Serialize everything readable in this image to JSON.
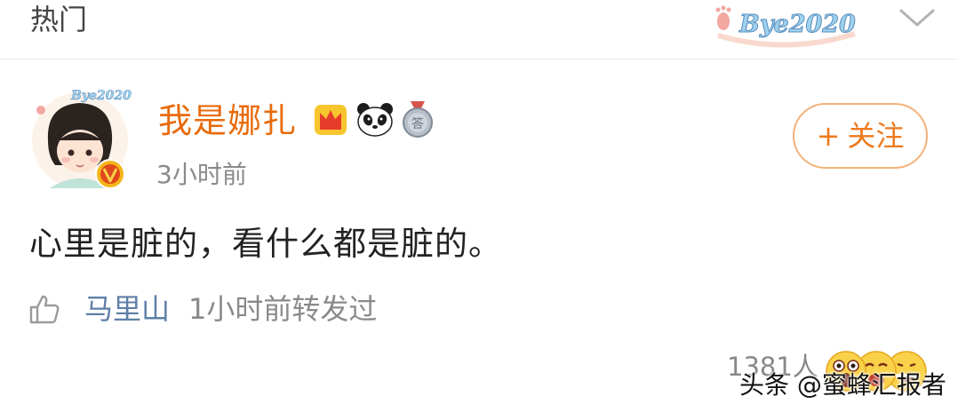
{
  "header": {
    "title": "热门",
    "logo_text": "Bye2020"
  },
  "post": {
    "avatar_text": "Bye2020",
    "username": "我是娜扎",
    "badges": [
      "crown-icon",
      "panda-icon",
      "medal-icon"
    ],
    "medal_label": "答",
    "time": "3小时前",
    "follow_label": "关注",
    "follow_plus": "+",
    "content": "心里是脏的，看什么都是脏的。",
    "repost_user": "马里山",
    "repost_info": "1小时前转发过",
    "reaction_count": "1381人",
    "reaction_emojis": [
      "shocked-emoji",
      "crying-emoji",
      "grinning-emoji"
    ]
  },
  "watermark": "头条 @蜜蜂汇报者",
  "colors": {
    "username": "#e86b0c",
    "follow_border": "#f3b27a",
    "follow_text": "#ec7a1e",
    "repost_user": "#5f7fa8",
    "meta_text": "#8a8a8a"
  }
}
